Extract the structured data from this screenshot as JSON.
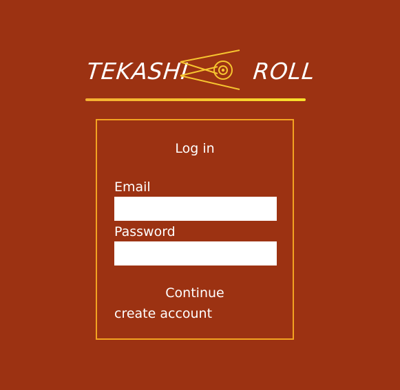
{
  "logo": {
    "left_text": "TEKASHI",
    "right_text": "ROLL",
    "emblem_icon": "chopsticks-roll-icon",
    "accent_color": "#f7c530"
  },
  "login": {
    "title": "Log in",
    "email_label": "Email",
    "email_value": "",
    "password_label": "Password",
    "password_value": "",
    "continue_label": "Continue",
    "create_account_label": "create account"
  },
  "colors": {
    "background": "#9c3212",
    "panel_border": "#f3a321"
  }
}
